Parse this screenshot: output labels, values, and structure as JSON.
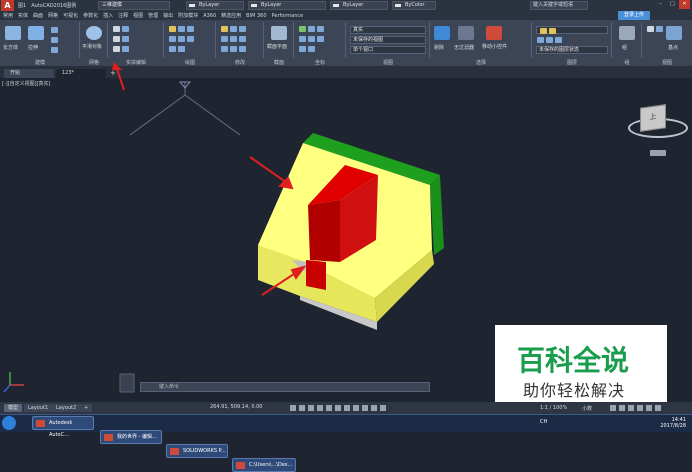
{
  "titlebar": {
    "app_name": "AutoCAD 2016",
    "quick_access": [
      "图1",
      "AutoCAD2016图例"
    ],
    "workspace": "三维建模",
    "properties": [
      "ByLayer",
      "ByLayer",
      "ByLayer"
    ],
    "color_box": "ByColor",
    "search_placeholder": "键入关键字或短语",
    "login_button": "登录上传"
  },
  "menubar": {
    "items": [
      "常用",
      "实体",
      "曲面",
      "网格",
      "可视化",
      "参数化",
      "插入",
      "注释",
      "视图",
      "管理",
      "输出",
      "附加模块",
      "A360",
      "精选应用",
      "BIM 360",
      "Performance"
    ]
  },
  "ribbon": {
    "groups": [
      {
        "label": "建模"
      },
      {
        "label": "网格"
      },
      {
        "label": "实体编辑"
      },
      {
        "label": "绘图"
      },
      {
        "label": "修改"
      },
      {
        "label": "截面"
      },
      {
        "label": "坐标"
      },
      {
        "label": "视图"
      },
      {
        "label": "选择"
      },
      {
        "label": "图层"
      },
      {
        "label": "组"
      },
      {
        "label": "视图"
      }
    ],
    "buttons": {
      "box": "长方体",
      "extrude": "拉伸",
      "smooth": "平滑对象",
      "section_plane": "截面平面",
      "culling": "剔除",
      "nofilter": "无过滤器",
      "move_gizmo": "移动小控件",
      "group": "组",
      "base": "基点"
    },
    "dropdowns": {
      "visual_style": "真实",
      "view": "未保存的视图",
      "viewport": "单个视口",
      "unsaved_layer_state": "未保存的图层状态"
    }
  },
  "tabs": [
    {
      "label": "开始"
    },
    {
      "label": "123*"
    }
  ],
  "viewport_label": "[-][自定义视图][真实]",
  "cube_label": "上",
  "command_line_placeholder": "键入命令",
  "layout_tabs": [
    "模型",
    "Layout1",
    "Layout2",
    "+"
  ],
  "coords": "264.91, 509.14, 0.00",
  "status_right": "小数",
  "scale": "1:1 / 100%",
  "taskbar": {
    "items": [
      "Autodesk AutoC...",
      "我的世界 - 编辑...",
      "SOLIDWORKS P...",
      "C:\\Users\\...\\Des..."
    ],
    "time": "14:41",
    "date": "2017/8/28",
    "ime": "CH"
  },
  "watermark": {
    "big": "百科全说",
    "small": "助你轻松解决"
  },
  "colors": {
    "viewport_bg": "#1f2530",
    "ribbon_bg": "#3b4556",
    "yellow_face": "#ffff80",
    "yellow_side": "#e6e65a",
    "green_face": "#1a9a1a",
    "red_face": "#d00000",
    "gray_face": "#c8c8c8",
    "arrow": "#e02020"
  }
}
